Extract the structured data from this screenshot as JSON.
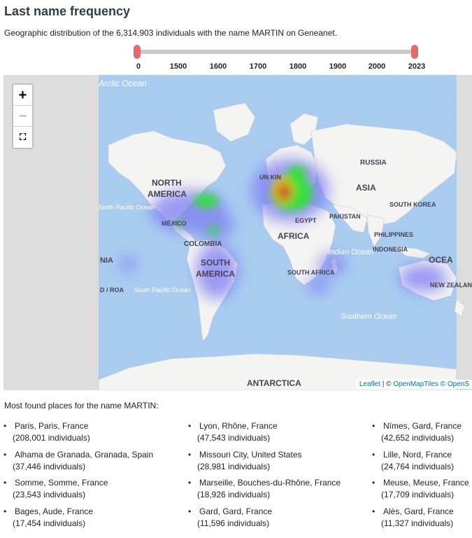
{
  "header": {
    "title": "Last name frequency",
    "subtitle": "Geographic distribution of the 6,314,903 individuals with the name MARTIN on Geneanet."
  },
  "slider": {
    "ticks": [
      "0",
      "1500",
      "1600",
      "1700",
      "1800",
      "1900",
      "2000",
      "2023"
    ],
    "range_start": "0",
    "range_end": "2023",
    "handle_color": "#e26a6a"
  },
  "map": {
    "zoom_in": "+",
    "zoom_out": "−",
    "fullscreen": "⛶",
    "labels": {
      "arctic": "Arctic Ocean",
      "north_america": "NORTH",
      "north_america_2": "AMERICA",
      "north_pacific": "North Pacific Ocean",
      "mexico": "MÉXICO",
      "colombia": "COLOMBIA",
      "south_america": "SOUTH",
      "south_america_2": "AMERICA",
      "south_pacific": "South Pacific Ocean",
      "russia": "RUSSIA",
      "asia": "ASIA",
      "south_korea": "SOUTH KOREA",
      "pakistan": "PAKISTAN",
      "egypt": "EGYPT",
      "africa": "AFRICA",
      "philippines": "PHILIPPINES",
      "indonesia": "INDONESIA",
      "indian_ocean": "Indian Ocean",
      "south_africa": "SOUTH AFRICA",
      "southern_ocean": "Southern Ocean",
      "antarctica": "ANTARCTICA",
      "oceania": "OCEA",
      "new_zealand": "NEW ZEALAN AOTEAR",
      "uk": "UN KIN",
      "left_nia": "NIA",
      "left_roa": "D / ROA"
    },
    "attribution": {
      "leaflet": "Leaflet",
      "sep": " | © ",
      "tiles": "OpenMapTiles",
      "osm": "© OpenS"
    }
  },
  "places": {
    "title": "Most found places for the name MARTIN:",
    "items": [
      {
        "name": "Paris, Paris, France",
        "count": "(208,001 individuals)"
      },
      {
        "name": "Lyon, Rhône, France",
        "count": "(47,543 individuals)"
      },
      {
        "name": "Nîmes, Gard, France",
        "count": "(42,652 individuals)"
      },
      {
        "name": "Alhama de Granada, Granada, Spain",
        "count": "(37,446 individuals)"
      },
      {
        "name": "Missouri City, United States",
        "count": "(28,981 individuals)"
      },
      {
        "name": "Lille, Nord, France",
        "count": "(24,764 individuals)"
      },
      {
        "name": "Somme, Somme, France",
        "count": "(23,543 individuals)"
      },
      {
        "name": "Marseille, Bouches-du-Rhône, France",
        "count": "(18,926 individuals)"
      },
      {
        "name": "Meuse, Meuse, France",
        "count": "(17,709 individuals)"
      },
      {
        "name": "Bages, Aude, France",
        "count": "(17,454 individuals)"
      },
      {
        "name": "Gard, Gard, France",
        "count": "(11,596 individuals)"
      },
      {
        "name": "Alès, Gard, France",
        "count": "(11,327 individuals)"
      }
    ]
  }
}
